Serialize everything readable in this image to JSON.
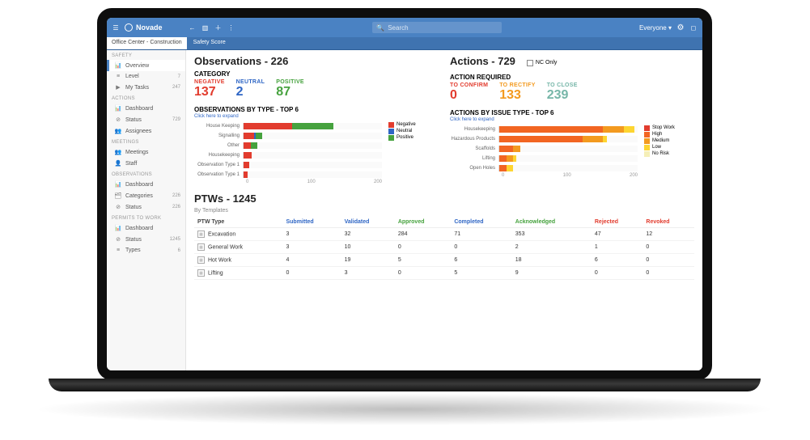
{
  "brand": "Novade",
  "search": {
    "placeholder": "Search"
  },
  "scope": "Everyone",
  "tabs": {
    "crumb": "Office Center - Construction",
    "active": "Safety Score"
  },
  "sidebar": {
    "groups": [
      {
        "label": "SAFETY",
        "items": [
          {
            "ic": "📊",
            "label": "Overview",
            "count": "",
            "active": true
          },
          {
            "ic": "≡",
            "label": "Level",
            "count": "7"
          },
          {
            "ic": "▶",
            "label": "My Tasks",
            "count": "247"
          }
        ]
      },
      {
        "label": "ACTIONS",
        "items": [
          {
            "ic": "📊",
            "label": "Dashboard",
            "count": ""
          },
          {
            "ic": "⊘",
            "label": "Status",
            "count": "729"
          },
          {
            "ic": "👥",
            "label": "Assignees",
            "count": ""
          }
        ]
      },
      {
        "label": "MEETINGS",
        "items": [
          {
            "ic": "👥",
            "label": "Meetings",
            "count": ""
          },
          {
            "ic": "👤",
            "label": "Staff",
            "count": ""
          }
        ]
      },
      {
        "label": "OBSERVATIONS",
        "items": [
          {
            "ic": "📊",
            "label": "Dashboard",
            "count": ""
          },
          {
            "ic": "🗂",
            "label": "Categories",
            "count": "226"
          },
          {
            "ic": "⊘",
            "label": "Status",
            "count": "226"
          }
        ]
      },
      {
        "label": "PERMITS TO WORK",
        "items": [
          {
            "ic": "📊",
            "label": "Dashboard",
            "count": ""
          },
          {
            "ic": "⊘",
            "label": "Status",
            "count": "1245"
          },
          {
            "ic": "≡",
            "label": "Types",
            "count": "6"
          }
        ]
      }
    ]
  },
  "obs": {
    "title": "Observations - 226",
    "cat_label": "CATEGORY",
    "stats": [
      {
        "label": "NEGATIVE",
        "value": "137",
        "cls": "c-red"
      },
      {
        "label": "NEUTRAL",
        "value": "2",
        "cls": "c-blue"
      },
      {
        "label": "POSITIVE",
        "value": "87",
        "cls": "c-green"
      }
    ],
    "chart_title": "OBSERVATIONS BY TYPE - TOP 6",
    "expand": "Click here to expand",
    "legend": [
      {
        "label": "Negative",
        "color": "#e23c2e"
      },
      {
        "label": "Neutral",
        "color": "#2f66c5"
      },
      {
        "label": "Positive",
        "color": "#46a23e"
      }
    ],
    "axis": [
      "0",
      "100",
      "200"
    ]
  },
  "act": {
    "title": "Actions - 729",
    "nc_label": "NC Only",
    "cat_label": "ACTION REQUIRED",
    "stats": [
      {
        "label": "TO CONFIRM",
        "value": "0",
        "cls": "c-red"
      },
      {
        "label": "TO RECTIFY",
        "value": "133",
        "cls": "c-org"
      },
      {
        "label": "TO CLOSE",
        "value": "239",
        "cls": "c-teal"
      }
    ],
    "chart_title": "ACTIONS BY ISSUE TYPE - TOP 6",
    "expand": "Click here to expand",
    "legend": [
      {
        "label": "Stop Work",
        "color": "#e23c2e"
      },
      {
        "label": "High",
        "color": "#f26522"
      },
      {
        "label": "Medium",
        "color": "#f39a1f"
      },
      {
        "label": "Low",
        "color": "#fdd531"
      },
      {
        "label": "No Risk",
        "color": "#f5efb8"
      }
    ],
    "axis": [
      "0",
      "100",
      "200"
    ]
  },
  "ptw": {
    "title": "PTWs - 1245",
    "subtitle": "By Templates",
    "headers": [
      "PTW Type",
      "Submitted",
      "Validated",
      "Approved",
      "Completed",
      "Acknowledged",
      "Rejected",
      "Revoked"
    ],
    "header_cls": [
      "",
      "c-blue",
      "c-blue",
      "c-green",
      "c-blue",
      "c-green",
      "c-red",
      "c-red"
    ],
    "rows": [
      [
        "Excavation",
        "3",
        "32",
        "284",
        "71",
        "353",
        "47",
        "12"
      ],
      [
        "General Work",
        "3",
        "10",
        "0",
        "0",
        "2",
        "1",
        "0"
      ],
      [
        "Hot Work",
        "4",
        "19",
        "5",
        "6",
        "18",
        "6",
        "0"
      ],
      [
        "Lifting",
        "0",
        "3",
        "0",
        "5",
        "9",
        "0",
        "0"
      ]
    ]
  },
  "chart_data": [
    {
      "type": "bar",
      "orientation": "horizontal",
      "title": "OBSERVATIONS BY TYPE - TOP 6",
      "xlim": [
        0,
        200
      ],
      "xticks": [
        0,
        100,
        200
      ],
      "categories": [
        "House Keeping",
        "Signalling",
        "Other",
        "Housekeeping",
        "Observation Type 1",
        "Observation Type 1"
      ],
      "series": [
        {
          "name": "Negative",
          "color": "#e23c2e",
          "values": [
            70,
            15,
            10,
            12,
            8,
            6
          ]
        },
        {
          "name": "Neutral",
          "color": "#2f66c5",
          "values": [
            0,
            2,
            0,
            0,
            0,
            0
          ]
        },
        {
          "name": "Positive",
          "color": "#46a23e",
          "values": [
            60,
            10,
            10,
            0,
            0,
            0
          ]
        }
      ]
    },
    {
      "type": "bar",
      "orientation": "horizontal",
      "title": "ACTIONS BY ISSUE TYPE - TOP 6",
      "xlim": [
        0,
        200
      ],
      "xticks": [
        0,
        100,
        200
      ],
      "categories": [
        "Housekeeping",
        "Hazardous Products",
        "Scaffolds",
        "Lifting",
        "Open Holes"
      ],
      "series": [
        {
          "name": "Stop Work",
          "color": "#e23c2e",
          "values": [
            0,
            0,
            0,
            0,
            0
          ]
        },
        {
          "name": "High",
          "color": "#f26522",
          "values": [
            150,
            120,
            20,
            10,
            10
          ]
        },
        {
          "name": "Medium",
          "color": "#f39a1f",
          "values": [
            30,
            30,
            10,
            10,
            0
          ]
        },
        {
          "name": "Low",
          "color": "#fdd531",
          "values": [
            15,
            5,
            0,
            5,
            10
          ]
        },
        {
          "name": "No Risk",
          "color": "#f5efb8",
          "values": [
            0,
            0,
            0,
            0,
            0
          ]
        }
      ]
    }
  ]
}
